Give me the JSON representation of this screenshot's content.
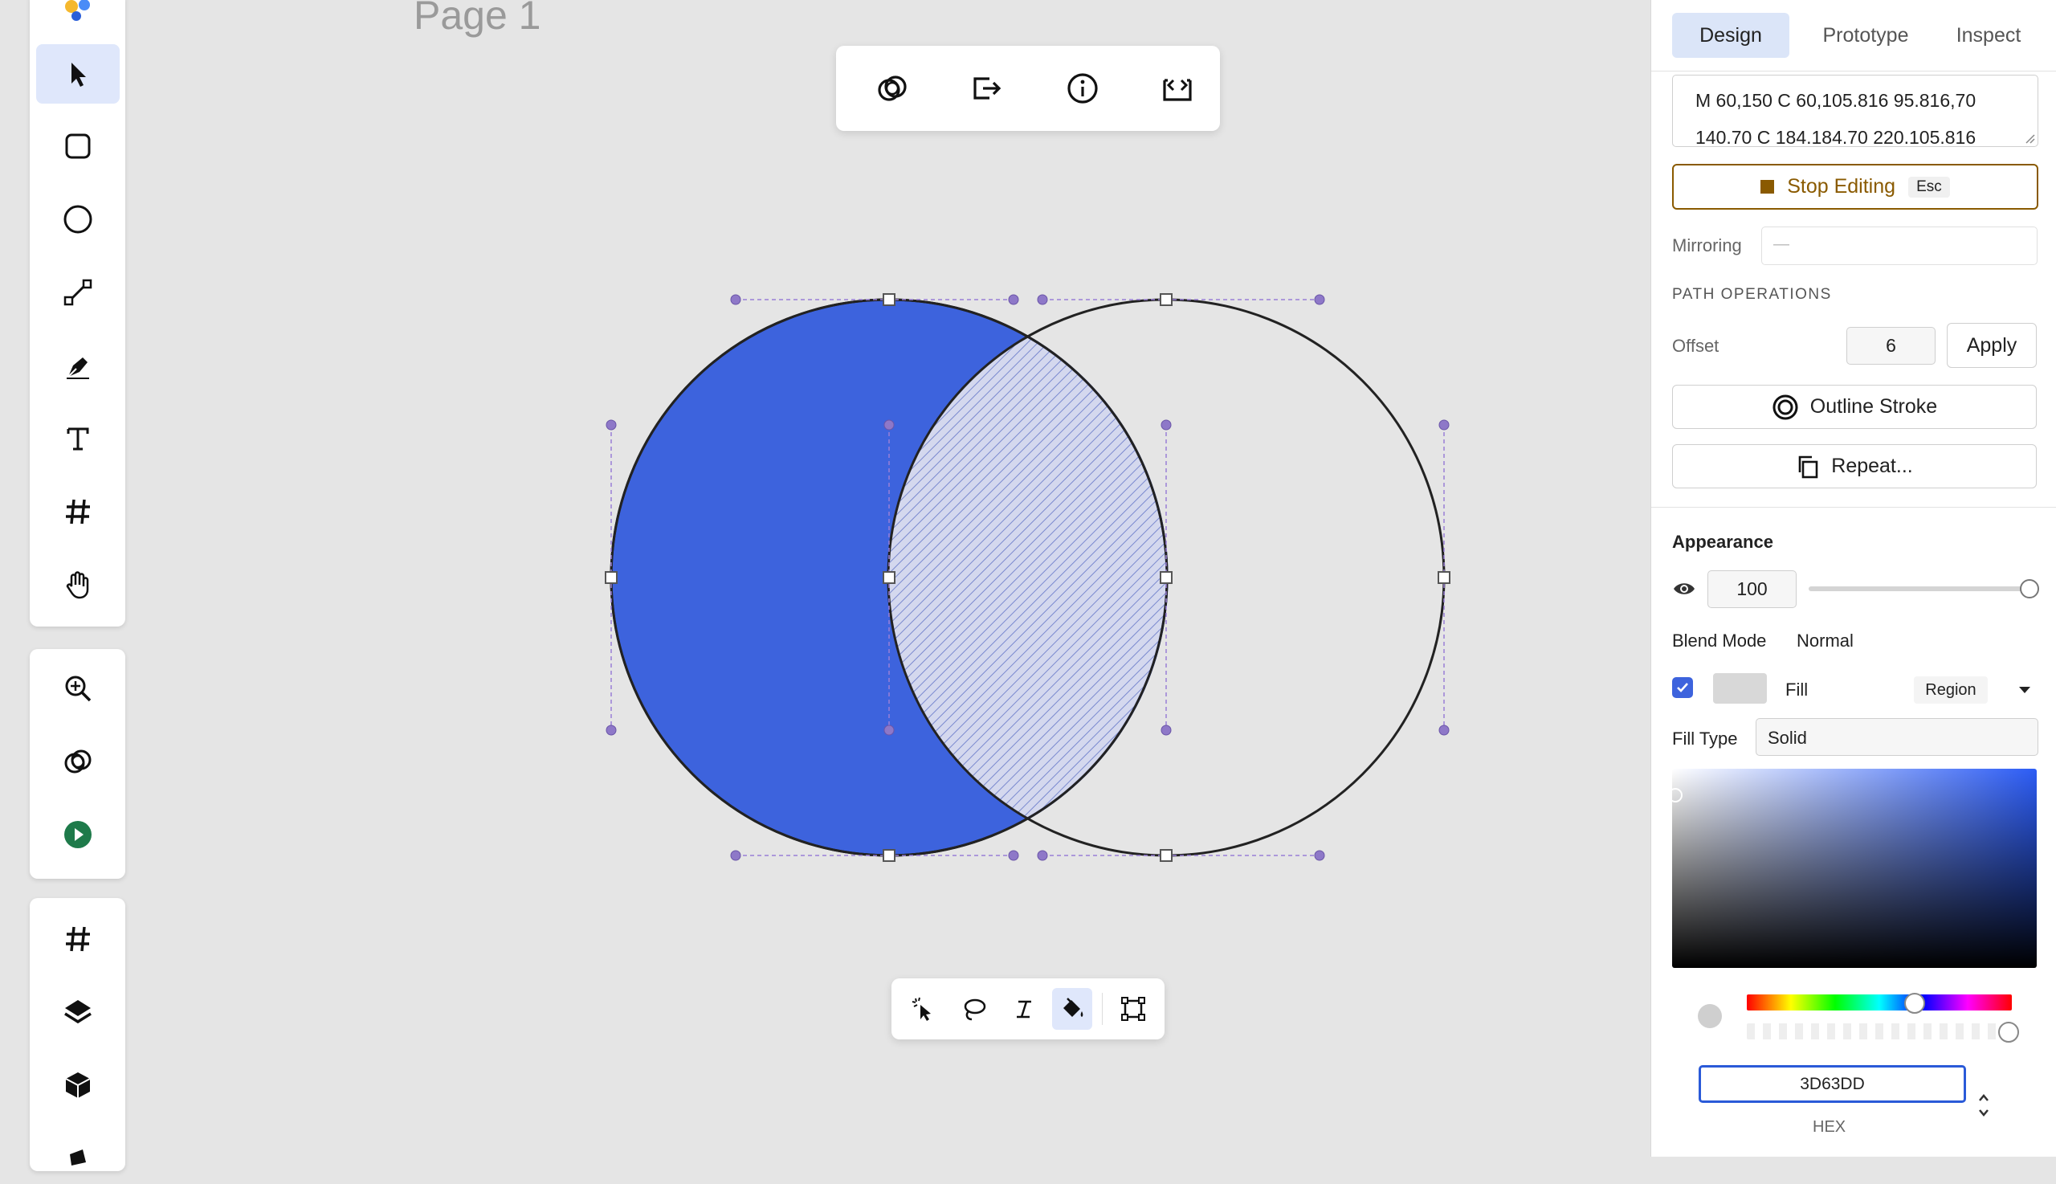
{
  "canvas": {
    "page_title": "Page 1"
  },
  "left_toolbar": {
    "tools": [
      {
        "name": "select-tool",
        "icon": "arrow-cursor-icon",
        "active": true
      },
      {
        "name": "rectangle-tool",
        "icon": "rounded-square-icon"
      },
      {
        "name": "ellipse-tool",
        "icon": "circle-icon"
      },
      {
        "name": "line-tool",
        "icon": "line-icon"
      },
      {
        "name": "pen-tool",
        "icon": "pen-nib-icon"
      },
      {
        "name": "text-tool",
        "icon": "text-t-icon"
      },
      {
        "name": "frame-tool",
        "icon": "hash-icon"
      },
      {
        "name": "hand-tool",
        "icon": "hand-icon"
      }
    ],
    "secondary": [
      "zoom-in-icon",
      "boolean-rings-icon",
      "play-icon"
    ],
    "bottom": [
      "hash-icon",
      "layers-icon",
      "cube-icon"
    ]
  },
  "top_toolbar": {
    "buttons": [
      "boolean-rings-icon",
      "export-icon",
      "info-icon",
      "code-embed-icon"
    ]
  },
  "bottom_toolbar": {
    "buttons": [
      "magic-select-icon",
      "lasso-icon",
      "italic-path-icon",
      "paint-bucket-icon",
      "transform-box-icon"
    ],
    "active": "paint-bucket-icon"
  },
  "panel": {
    "tabs": [
      "Design",
      "Prototype",
      "Inspect"
    ],
    "active_tab": "Design",
    "path_data_line1": "M 60,150 C 60,105.816 95.816,70",
    "path_data_line2": "140.70 C 184.184.70 220.105.816",
    "stop_editing_label": "Stop Editing",
    "stop_editing_shortcut": "Esc",
    "mirroring_label": "Mirroring",
    "mirroring_value": "—",
    "path_ops_heading": "PATH OPERATIONS",
    "offset_label": "Offset",
    "offset_value": "6",
    "apply_label": "Apply",
    "outline_stroke_label": "Outline Stroke",
    "repeat_label": "Repeat...",
    "appearance_heading": "Appearance",
    "opacity_value": "100",
    "blend_mode_label": "Blend Mode",
    "blend_mode_value": "Normal",
    "fill_label": "Fill",
    "fill_scope": "Region",
    "fill_type_label": "Fill Type",
    "fill_type_value": "Solid",
    "hex_value": "3D63DD",
    "hex_label": "HEX"
  },
  "colors": {
    "accent": "#3D63DD",
    "stop_editing": "#8a5a00",
    "canvas_bg": "#e5e5e5",
    "selection": "#9a7fd6"
  }
}
